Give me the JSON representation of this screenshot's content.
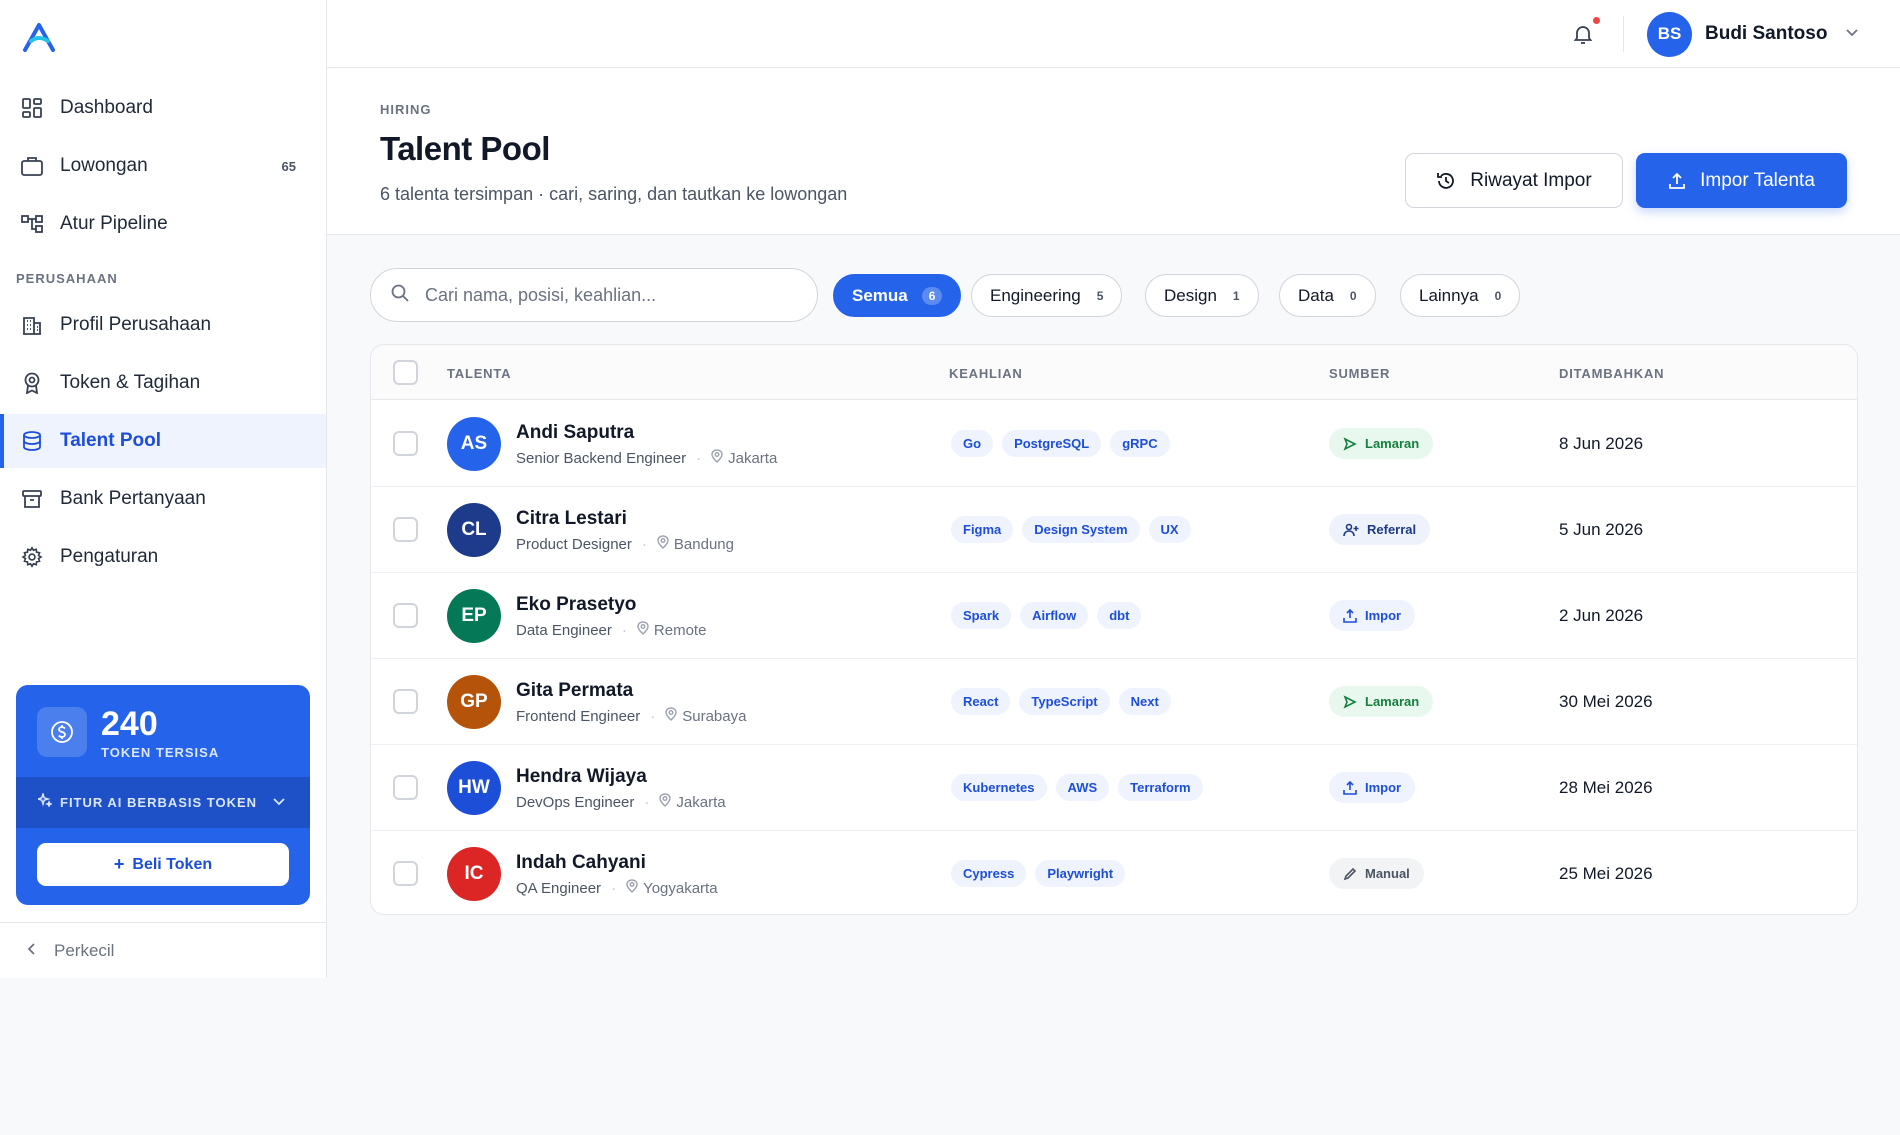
{
  "sidebar": {
    "nav": [
      {
        "label": "Dashboard",
        "icon": "dashboard-icon"
      },
      {
        "label": "Lowongan",
        "icon": "briefcase-icon",
        "count": "65"
      },
      {
        "label": "Atur Pipeline",
        "icon": "pipeline-icon"
      }
    ],
    "section_label": "PERUSAHAAN",
    "nav2": [
      {
        "label": "Profil Perusahaan",
        "icon": "building-icon"
      },
      {
        "label": "Token & Tagihan",
        "icon": "badge-icon"
      },
      {
        "label": "Talent Pool",
        "icon": "database-icon",
        "active": true
      },
      {
        "label": "Bank Pertanyaan",
        "icon": "archive-icon"
      },
      {
        "label": "Pengaturan",
        "icon": "gear-icon"
      }
    ],
    "token": {
      "value": "240",
      "label": "TOKEN TERSISA",
      "ai_label": "FITUR AI BERBASIS TOKEN",
      "buy_label": "Beli Token"
    },
    "collapse_label": "Perkecil"
  },
  "topbar": {
    "user_initials": "BS",
    "user_name": "Budi Santoso"
  },
  "header": {
    "breadcrumb": "HIRING",
    "title": "Talent Pool",
    "subtitle": "6 talenta tersimpan · cari, saring, dan tautkan ke lowongan",
    "history_button": "Riwayat Impor",
    "import_button": "Impor Talenta"
  },
  "search": {
    "placeholder": "Cari nama, posisi, keahlian...",
    "value": ""
  },
  "filters": [
    {
      "label": "Semua",
      "count": "6",
      "active": true
    },
    {
      "label": "Engineering",
      "count": "5"
    },
    {
      "label": "Design",
      "count": "1"
    },
    {
      "label": "Data",
      "count": "0"
    },
    {
      "label": "Lainnya",
      "count": "0"
    }
  ],
  "table": {
    "columns": [
      "TALENTA",
      "KEAHLIAN",
      "SUMBER",
      "DITAMBAHKAN"
    ],
    "rows": [
      {
        "initials": "AS",
        "color": "#2563eb",
        "name": "Andi Saputra",
        "role": "Senior Backend Engineer",
        "location": "Jakarta",
        "skills": [
          "Go",
          "PostgreSQL",
          "gRPC"
        ],
        "source": "Lamaran",
        "source_type": "lamaran",
        "date": "8 Jun 2026"
      },
      {
        "initials": "CL",
        "color": "#1e3a8a",
        "name": "Citra Lestari",
        "role": "Product Designer",
        "location": "Bandung",
        "skills": [
          "Figma",
          "Design System",
          "UX"
        ],
        "source": "Referral",
        "source_type": "referral",
        "date": "5 Jun 2026"
      },
      {
        "initials": "EP",
        "color": "#047857",
        "name": "Eko Prasetyo",
        "role": "Data Engineer",
        "location": "Remote",
        "skills": [
          "Spark",
          "Airflow",
          "dbt"
        ],
        "source": "Impor",
        "source_type": "impor",
        "date": "2 Jun 2026"
      },
      {
        "initials": "GP",
        "color": "#b45309",
        "name": "Gita Permata",
        "role": "Frontend Engineer",
        "location": "Surabaya",
        "skills": [
          "React",
          "TypeScript",
          "Next"
        ],
        "source": "Lamaran",
        "source_type": "lamaran",
        "date": "30 Mei 2026"
      },
      {
        "initials": "HW",
        "color": "#1d4ed8",
        "name": "Hendra Wijaya",
        "role": "DevOps Engineer",
        "location": "Jakarta",
        "skills": [
          "Kubernetes",
          "AWS",
          "Terraform"
        ],
        "source": "Impor",
        "source_type": "impor",
        "date": "28 Mei 2026"
      },
      {
        "initials": "IC",
        "color": "#dc2626",
        "name": "Indah Cahyani",
        "role": "QA Engineer",
        "location": "Yogyakarta",
        "skills": [
          "Cypress",
          "Playwright"
        ],
        "source": "Manual",
        "source_type": "manual",
        "date": "25 Mei 2026"
      }
    ]
  },
  "colors": {
    "accent": "#2563eb",
    "accent_dark": "#1d4ed8",
    "notification_dot": "#ef4444"
  }
}
